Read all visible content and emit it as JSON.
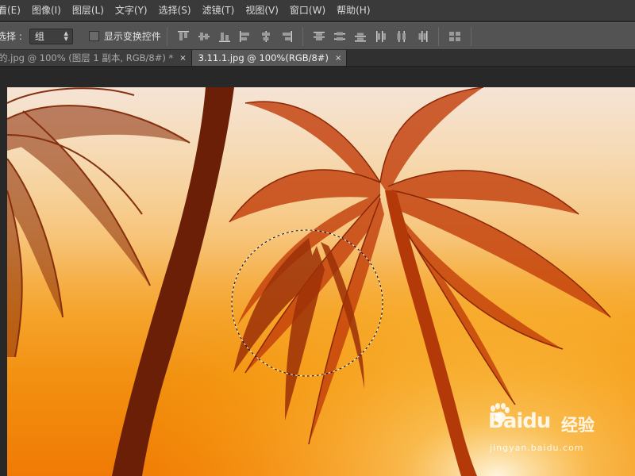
{
  "menu": {
    "items": [
      "看(E)",
      "图像(I)",
      "图层(L)",
      "文字(Y)",
      "选择(S)",
      "滤镜(T)",
      "视图(V)",
      "窗口(W)",
      "帮助(H)"
    ]
  },
  "options": {
    "auto_select_label": "选择 :",
    "select_value": "组",
    "show_transform_label": "显示变换控件"
  },
  "tabs": [
    {
      "label": "的.jpg @ 100% (图层 1 副本, RGB/8#) *",
      "close": "×"
    },
    {
      "label": "3.11.1.jpg @ 100%(RGB/8#)",
      "close": "×"
    }
  ],
  "watermark": {
    "brand": "Bai",
    "brand_du": "du",
    "brand_cn": "经验",
    "url": "jingyan.baidu.com"
  },
  "colors": {
    "menubar": "#3a3a3a",
    "optionsbar": "#535353",
    "workspace": "#282828",
    "palm_dark": "#7a2205",
    "palm_mid": "#b33a08"
  }
}
